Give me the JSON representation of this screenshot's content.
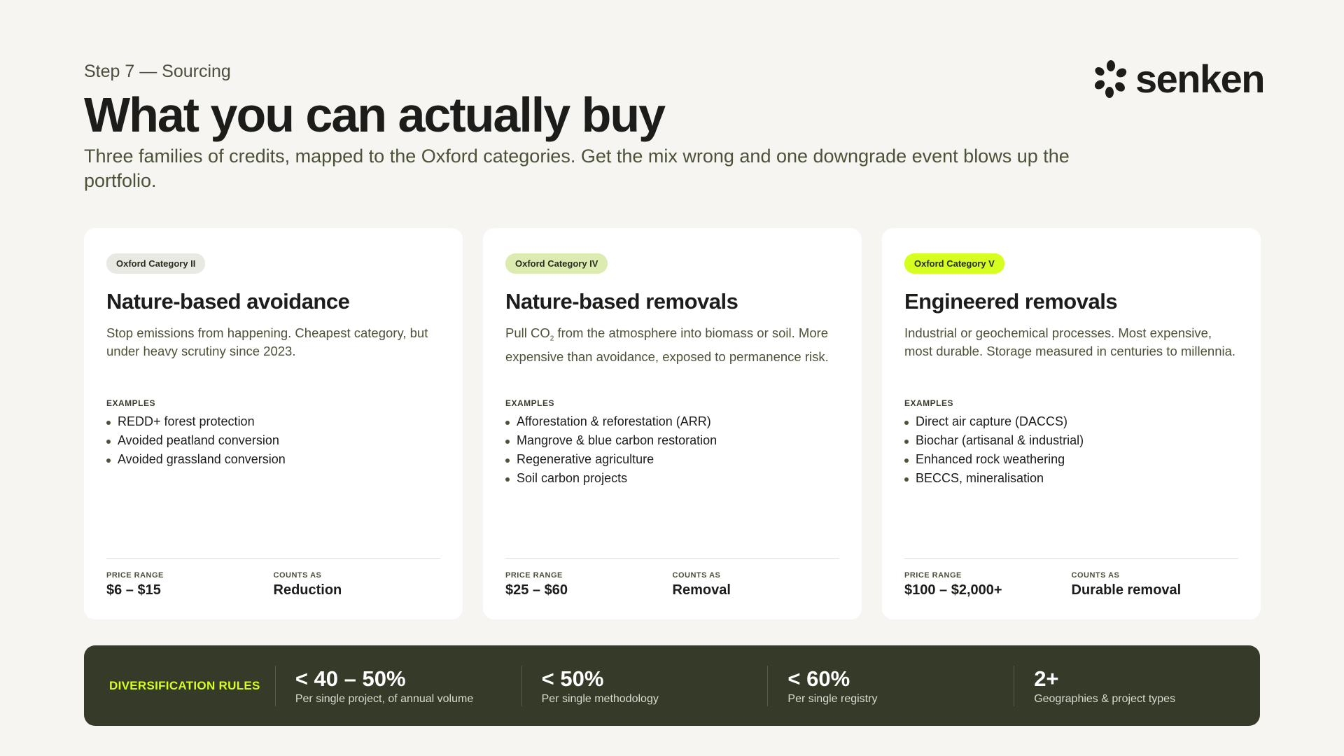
{
  "header": {
    "eyebrow": "Step 7 — Sourcing",
    "title": "What you can actually buy",
    "subtitle": "Three families of credits, mapped to the Oxford categories. Get the mix wrong and one downgrade event blows up the portfolio."
  },
  "brand": {
    "name": "senken",
    "icon": "flower-dots-logo-icon"
  },
  "colors": {
    "background": "#f6f5f2",
    "dark_panel": "#363a28",
    "accent_lime": "#d4ff1f",
    "badge_ii": "#e8e9e2",
    "badge_iv": "#dcebb0",
    "badge_v": "#d4ff1f"
  },
  "cards": [
    {
      "badge": "Oxford Category II",
      "title": "Nature-based avoidance",
      "desc": "Stop emissions from happening. Cheapest category, but under heavy scrutiny since 2023.",
      "examples_label": "EXAMPLES",
      "examples": [
        "REDD+ forest protection",
        "Avoided peatland conversion",
        "Avoided grassland conversion"
      ],
      "price_label": "PRICE RANGE",
      "price": "$6 – $15",
      "counts_label": "COUNTS AS",
      "counts": "Reduction"
    },
    {
      "badge": "Oxford Category IV",
      "title": "Nature-based removals",
      "desc_a": "Pull CO",
      "desc_sub": "2",
      "desc_b": " from the atmosphere into biomass or soil. More expensive than avoidance, exposed to permanence risk.",
      "examples_label": "EXAMPLES",
      "examples": [
        "Afforestation & reforestation (ARR)",
        "Mangrove & blue carbon restoration",
        "Regenerative agriculture",
        "Soil carbon projects"
      ],
      "price_label": "PRICE RANGE",
      "price": "$25 – $60",
      "counts_label": "COUNTS AS",
      "counts": "Removal"
    },
    {
      "badge": "Oxford Category V",
      "title": "Engineered removals",
      "desc": "Industrial or geochemical processes. Most expensive, most durable. Storage measured in centuries to millennia.",
      "examples_label": "EXAMPLES",
      "examples": [
        "Direct air capture (DACCS)",
        "Biochar (artisanal & industrial)",
        "Enhanced rock weathering",
        "BECCS, mineralisation"
      ],
      "price_label": "PRICE RANGE",
      "price": "$100 – $2,000+",
      "counts_label": "COUNTS AS",
      "counts": "Durable removal"
    }
  ],
  "rules": {
    "label": "DIVERSIFICATION RULES",
    "items": [
      {
        "value": "< 40 – 50%",
        "desc": "Per single project, of annual volume"
      },
      {
        "value": "< 50%",
        "desc": "Per single methodology"
      },
      {
        "value": "< 60%",
        "desc": "Per single registry"
      },
      {
        "value": "2+",
        "desc": "Geographies & project types"
      }
    ]
  }
}
